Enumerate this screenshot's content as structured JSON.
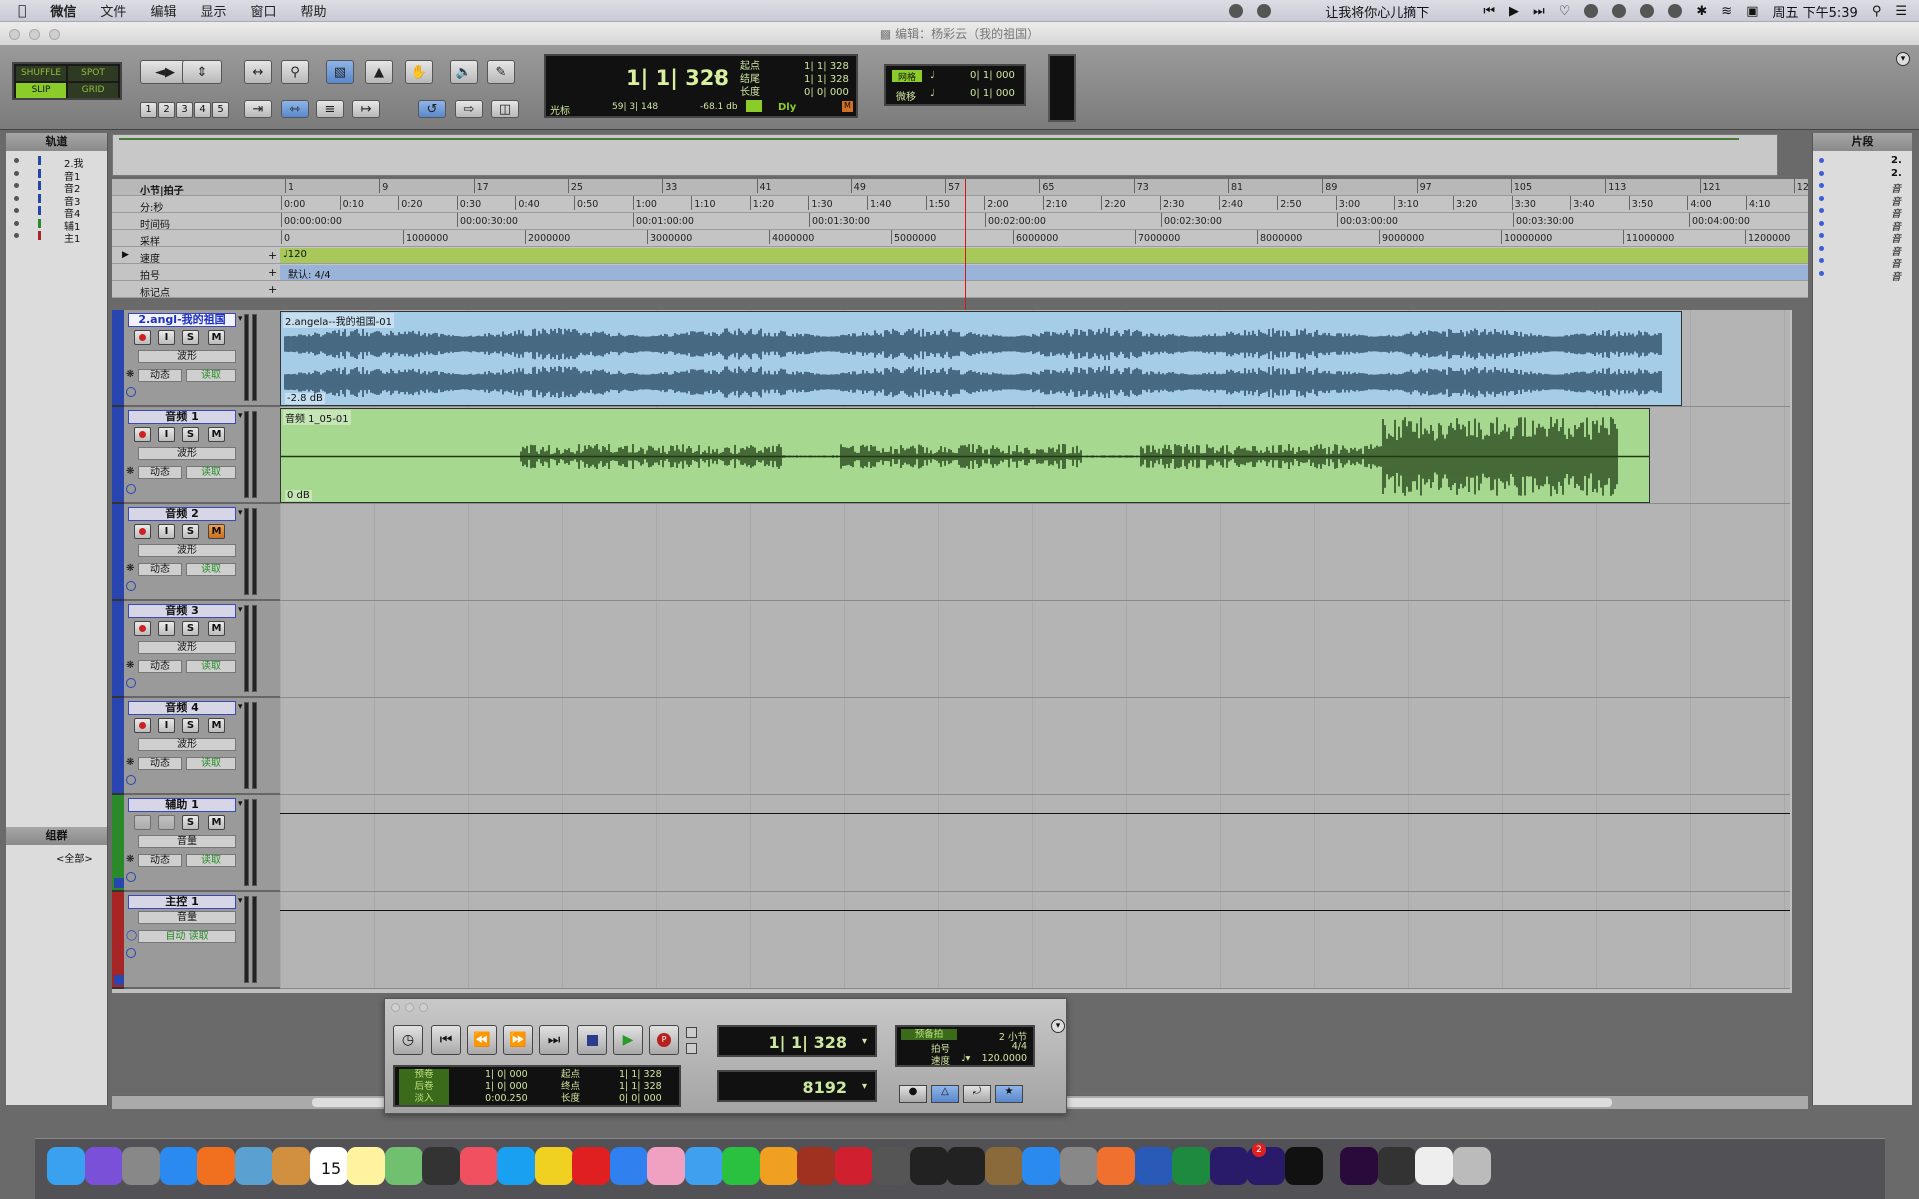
{
  "menubar": {
    "items": [
      "微信",
      "文件",
      "编辑",
      "显示",
      "窗口",
      "帮助"
    ],
    "now_playing": "让我将你心儿摘下",
    "clock": "周五 下午5:39"
  },
  "window": {
    "title": "编辑：杨彩云（我的祖国）"
  },
  "toolbar": {
    "modes": [
      "SHUFFLE",
      "SPOT",
      "SLIP",
      "GRID"
    ],
    "active_mode": "SLIP",
    "zoom_presets": [
      "1",
      "2",
      "3",
      "4",
      "5"
    ],
    "main_counter": "1| 1| 328",
    "sel_labels": [
      "起点",
      "结尾",
      "长度"
    ],
    "sel_values": [
      "1| 1| 328",
      "1| 1| 328",
      "0| 0| 000"
    ],
    "cursor_label": "光标",
    "cursor_value": "59| 3| 148",
    "cursor_db": "-68.1 db",
    "dly": "Dly",
    "grid_label": "网格",
    "grid_value": "0| 1| 000",
    "nudge_label": "微移",
    "nudge_value": "0| 1| 000"
  },
  "left_panel": {
    "tracks_title": "轨道",
    "tracks": [
      "2.我",
      "音1",
      "音2",
      "音3",
      "音4",
      "辅1",
      "主1"
    ],
    "groups_title": "组群",
    "groups_all": "<全部>"
  },
  "right_panel": {
    "title": "片段",
    "clips": [
      "2.",
      "2.",
      "音",
      "音",
      "音",
      "音",
      "音",
      "音",
      "音",
      "音"
    ]
  },
  "rulers": {
    "labels": [
      "小节|拍子",
      "分:秒",
      "时间码",
      "采样",
      "速度",
      "拍号",
      "标记点"
    ],
    "bars": [
      "1",
      "9",
      "17",
      "25",
      "33",
      "41",
      "49",
      "57",
      "65",
      "73",
      "81",
      "89",
      "97",
      "105",
      "113",
      "121",
      "12"
    ],
    "minsec": [
      "0:00",
      "0:10",
      "0:20",
      "0:30",
      "0:40",
      "0:50",
      "1:00",
      "1:10",
      "1:20",
      "1:30",
      "1:40",
      "1:50",
      "2:00",
      "2:10",
      "2:20",
      "2:30",
      "2:40",
      "2:50",
      "3:00",
      "3:10",
      "3:20",
      "3:30",
      "3:40",
      "3:50",
      "4:00",
      "4:10"
    ],
    "timecode": [
      "00:00:00:00",
      "00:00:30:00",
      "00:01:00:00",
      "00:01:30:00",
      "00:02:00:00",
      "00:02:30:00",
      "00:03:00:00",
      "00:03:30:00",
      "00:04:00:00"
    ],
    "samples": [
      "0",
      "1000000",
      "2000000",
      "3000000",
      "4000000",
      "5000000",
      "6000000",
      "7000000",
      "8000000",
      "9000000",
      "10000000",
      "11000000",
      "1200000"
    ],
    "tempo": "♩120",
    "meter": "默认: 4/4"
  },
  "tracks": [
    {
      "name": "2.angl-我的祖国",
      "view": "波形",
      "dyn": "动态",
      "auto": "读取",
      "clip": "2.angela--我的祖国-01",
      "gain": "-2.8 dB",
      "color": "#a6cde8",
      "wave": "#1f3f58"
    },
    {
      "name": "音频 1",
      "view": "波形",
      "dyn": "动态",
      "auto": "读取",
      "clip": "音频 1_05-01",
      "gain": "0 dB",
      "color": "#a6d890",
      "wave": "#1d3a12"
    },
    {
      "name": "音频 2",
      "view": "波形",
      "dyn": "动态",
      "auto": "读取"
    },
    {
      "name": "音频 3",
      "view": "波形",
      "dyn": "动态",
      "auto": "读取"
    },
    {
      "name": "音频 4",
      "view": "波形",
      "dyn": "动态",
      "auto": "读取"
    },
    {
      "name": "辅助 1",
      "view": "音量",
      "dyn": "动态",
      "auto": "读取"
    },
    {
      "name": "主控 1",
      "view": "音量",
      "auto": "自动 读取"
    }
  ],
  "transport": {
    "main": "1| 1| 328",
    "sub": "8192",
    "pre_labels": [
      "预卷",
      "后卷",
      "淡入"
    ],
    "pre_values": [
      "1| 0| 000",
      "1| 0| 000",
      "0:00.250"
    ],
    "sel_labels": [
      "起点",
      "终点",
      "长度"
    ],
    "sel_values": [
      "1| 1| 328",
      "1| 1| 328",
      "0| 0| 000"
    ],
    "countoff_label": "预备拍",
    "countoff_value": "2 小节",
    "meter_label": "拍号",
    "meter_value": "4/4",
    "tempo_label": "速度",
    "tempo_value": "120.0000"
  },
  "dock": {
    "calendar_day": "15",
    "badge": "2",
    "apps": [
      "Finder",
      "Siri",
      "Launchpad",
      "Safari",
      "Firefox",
      "Preview",
      "Books",
      "Calendar",
      "Notes",
      "Maps",
      "Final Cut",
      "Music",
      "App",
      "QQ Music",
      "NetEase",
      "K",
      "Photos",
      "Lattice",
      "WeChat",
      "Pro Tools",
      "Games",
      "Cubase",
      "Disk",
      "Pro Tools First",
      "Audio",
      "Lurssen",
      "App Store",
      "Settings",
      "Pages",
      "Word",
      "Excel",
      "Ae",
      "Ps Helper",
      "QQ",
      "Pr",
      "Finder2",
      "Notes2",
      "Trash"
    ]
  }
}
